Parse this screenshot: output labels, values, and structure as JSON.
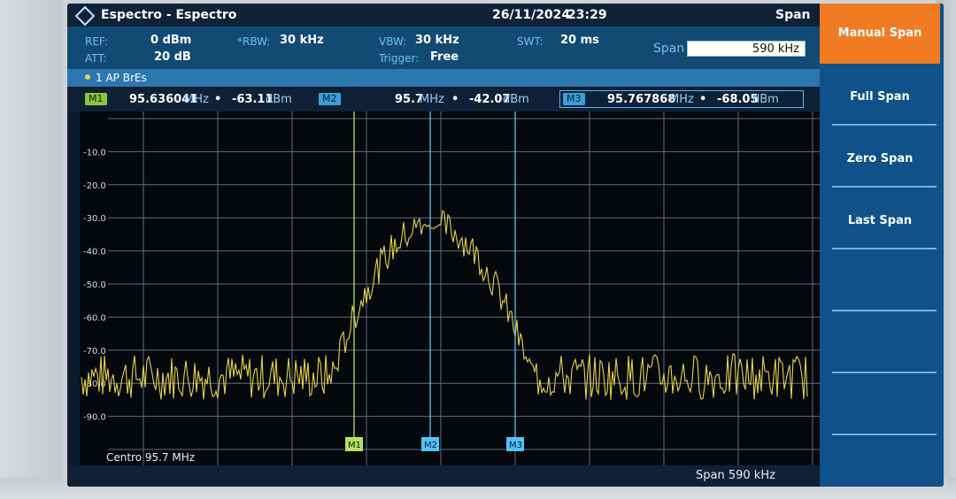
{
  "titlebar": {
    "app_title": "Espectro - Espectro",
    "date": "26/11/2024",
    "time": "23:29",
    "mode": "Span"
  },
  "settings": {
    "ref_label": "REF:",
    "ref_value": "0 dBm",
    "att_label": "ATT:",
    "att_value": "20 dB",
    "rbw_label": "*RBW:",
    "rbw_value": "30 kHz",
    "vbw_label": "VBW:",
    "vbw_value": "30 kHz",
    "trigger_label": "Trigger:",
    "trigger_value": "Free",
    "swt_label": "SWT:",
    "swt_value": "20 ms",
    "span_label": "Span",
    "span_value": "590 kHz"
  },
  "trace": {
    "label": "1 AP  BrEs",
    "color": "#e6d24a"
  },
  "markers": [
    {
      "tag": "M1",
      "freq": "95.636041",
      "freq_unit": "MHz",
      "sep": "•",
      "level": "-63.11",
      "level_unit": "dBm"
    },
    {
      "tag": "M2",
      "freq": "95.7",
      "freq_unit": "MHz",
      "sep": "•",
      "level": "-42.07",
      "level_unit": "dBm"
    },
    {
      "tag": "M3",
      "freq": "95.767868",
      "freq_unit": "MHz",
      "sep": "•",
      "level": "-68.05",
      "level_unit": "dBm"
    }
  ],
  "plot": {
    "y_ticks": [
      "-10.0",
      "-20.0",
      "-30.0",
      "-40.0",
      "-50.0",
      "-60.0",
      "-70.0",
      "-80.0",
      "-90.0"
    ],
    "center_label": "Centro 95.7 MHz",
    "span_label": "Span 590 kHz",
    "trace_color": "#e6d24a",
    "marker_line_m1": "#b6e25a",
    "marker_line_m2m3": "#4fc3f7"
  },
  "softkeys": [
    {
      "label": "Manual Span",
      "active": true
    },
    {
      "label": "Full Span",
      "active": false
    },
    {
      "label": "Zero Span",
      "active": false
    },
    {
      "label": "Last Span",
      "active": false
    },
    {
      "label": "",
      "active": false
    },
    {
      "label": "",
      "active": false
    },
    {
      "label": "",
      "active": false
    }
  ]
}
